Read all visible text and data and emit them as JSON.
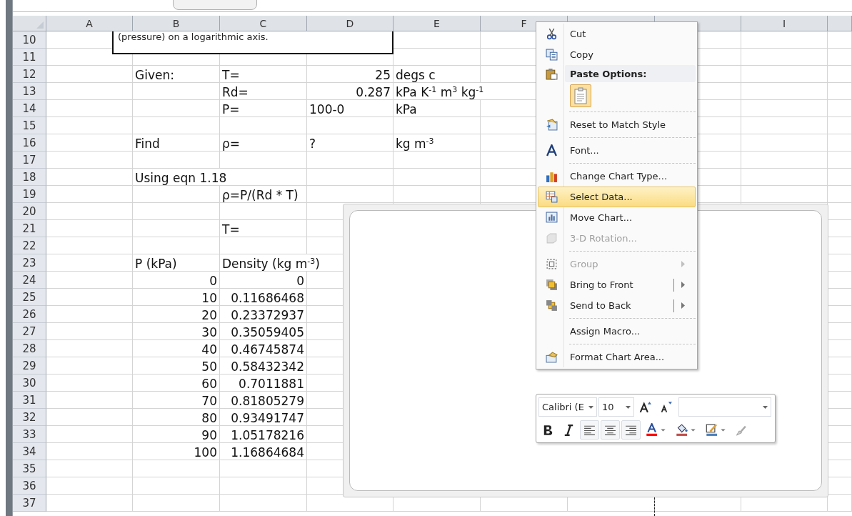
{
  "columns": [
    {
      "label": "A"
    },
    {
      "label": "B"
    },
    {
      "label": "C"
    },
    {
      "label": "D"
    },
    {
      "label": "E"
    },
    {
      "label": "F"
    },
    {},
    {},
    {
      "label": "I"
    }
  ],
  "text_box": {
    "text": "(pressure) on a logarithmic axis."
  },
  "rows": [
    {
      "number": "10",
      "cells": {}
    },
    {
      "number": "11",
      "cells": {}
    },
    {
      "number": "12",
      "cells": {
        "B": {
          "text": "Given:",
          "right_aligned": false
        },
        "C": {
          "text": "T=",
          "right_aligned": false
        },
        "D": {
          "text": "25",
          "right_aligned": true
        },
        "E": {
          "text": "degs c",
          "right_aligned": false
        }
      }
    },
    {
      "number": "13",
      "cells": {
        "C": {
          "text": "Rd=",
          "right_aligned": false
        },
        "D": {
          "text": "0.287",
          "right_aligned": true
        },
        "E": {
          "text": "kPa K$^{-1}$ m$^{3}$ kg$^{-1}$",
          "right_aligned": false
        }
      }
    },
    {
      "number": "14",
      "cells": {
        "C": {
          "text": "P=",
          "right_aligned": false
        },
        "D": {
          "text": "100-0",
          "right_aligned": false
        },
        "E": {
          "text": "kPa",
          "right_aligned": false
        }
      }
    },
    {
      "number": "15",
      "cells": {}
    },
    {
      "number": "16",
      "cells": {
        "B": {
          "text": "Find",
          "right_aligned": false
        },
        "C": {
          "text": "ρ=",
          "right_aligned": false
        },
        "D": {
          "text": "?",
          "right_aligned": false
        },
        "E": {
          "text": "kg m$^{-3}$",
          "right_aligned": false
        }
      }
    },
    {
      "number": "17",
      "cells": {}
    },
    {
      "number": "18",
      "cells": {
        "B": {
          "text": "Using eqn 1.18",
          "right_aligned": false
        }
      }
    },
    {
      "number": "19",
      "cells": {
        "C": {
          "text": "ρ=P/(Rd * T)",
          "right_aligned": false
        }
      }
    },
    {
      "number": "20",
      "cells": {}
    },
    {
      "number": "21",
      "cells": {
        "C": {
          "text": "T=",
          "right_aligned": false
        }
      }
    },
    {
      "number": "22",
      "cells": {}
    },
    {
      "number": "23",
      "cells": {
        "B": {
          "text": "P (kPa)",
          "right_aligned": false
        },
        "C": {
          "text": "Density (kg m$^{-3}$)",
          "right_aligned": false
        }
      }
    },
    {
      "number": "24",
      "cells": {
        "B": {
          "text": "0",
          "right_aligned": true
        },
        "C": {
          "text": "0",
          "right_aligned": true
        }
      }
    },
    {
      "number": "25",
      "cells": {
        "B": {
          "text": "10",
          "right_aligned": true
        },
        "C": {
          "text": "0.11686468",
          "right_aligned": true
        }
      }
    },
    {
      "number": "26",
      "cells": {
        "B": {
          "text": "20",
          "right_aligned": true
        },
        "C": {
          "text": "0.23372937",
          "right_aligned": true
        }
      }
    },
    {
      "number": "27",
      "cells": {
        "B": {
          "text": "30",
          "right_aligned": true
        },
        "C": {
          "text": "0.35059405",
          "right_aligned": true
        }
      }
    },
    {
      "number": "28",
      "cells": {
        "B": {
          "text": "40",
          "right_aligned": true
        },
        "C": {
          "text": "0.46745874",
          "right_aligned": true
        }
      }
    },
    {
      "number": "29",
      "cells": {
        "B": {
          "text": "50",
          "right_aligned": true
        },
        "C": {
          "text": "0.58432342",
          "right_aligned": true
        }
      }
    },
    {
      "number": "30",
      "cells": {
        "B": {
          "text": "60",
          "right_aligned": true
        },
        "C": {
          "text": "0.7011881",
          "right_aligned": true
        }
      }
    },
    {
      "number": "31",
      "cells": {
        "B": {
          "text": "70",
          "right_aligned": true
        },
        "C": {
          "text": "0.81805279",
          "right_aligned": true
        }
      }
    },
    {
      "number": "32",
      "cells": {
        "B": {
          "text": "80",
          "right_aligned": true
        },
        "C": {
          "text": "0.93491747",
          "right_aligned": true
        }
      }
    },
    {
      "number": "33",
      "cells": {
        "B": {
          "text": "90",
          "right_aligned": true
        },
        "C": {
          "text": "1.05178216",
          "right_aligned": true
        }
      }
    },
    {
      "number": "34",
      "cells": {
        "B": {
          "text": "100",
          "right_aligned": true
        },
        "C": {
          "text": "1.16864684",
          "right_aligned": true
        }
      }
    },
    {
      "number": "35",
      "cells": {}
    },
    {
      "number": "36",
      "cells": {}
    },
    {
      "number": "37",
      "cells": {}
    }
  ],
  "context_menu": {
    "items": [
      {
        "kind": "item",
        "label": "Cut",
        "selected": false,
        "disabled": false,
        "submenu": false,
        "split": false,
        "separator_before": false
      },
      {
        "kind": "item",
        "label": "Copy",
        "selected": false,
        "disabled": false,
        "submenu": false,
        "split": false,
        "separator_before": false
      },
      {
        "kind": "header",
        "label": "Paste Options:",
        "separator_before": false
      },
      {
        "kind": "paste",
        "selected": true,
        "separator_before": false
      },
      {
        "kind": "item",
        "label": "Reset to Match Style",
        "selected": false,
        "disabled": false,
        "submenu": false,
        "split": false,
        "separator_before": true
      },
      {
        "kind": "item",
        "label": "Font...",
        "selected": false,
        "disabled": false,
        "submenu": false,
        "split": false,
        "separator_before": true
      },
      {
        "kind": "item",
        "label": "Change Chart Type...",
        "selected": false,
        "disabled": false,
        "submenu": false,
        "split": false,
        "separator_before": true
      },
      {
        "kind": "item",
        "label": "Select Data...",
        "selected": true,
        "disabled": false,
        "submenu": false,
        "split": false,
        "separator_before": false
      },
      {
        "kind": "item",
        "label": "Move Chart...",
        "selected": false,
        "disabled": false,
        "submenu": false,
        "split": false,
        "separator_before": false
      },
      {
        "kind": "item",
        "label": "3-D Rotation...",
        "selected": false,
        "disabled": true,
        "submenu": false,
        "split": false,
        "separator_before": false
      },
      {
        "kind": "item",
        "label": "Group",
        "selected": false,
        "disabled": true,
        "submenu": true,
        "split": false,
        "separator_before": true
      },
      {
        "kind": "item",
        "label": "Bring to Front",
        "selected": false,
        "disabled": false,
        "submenu": true,
        "split": true,
        "separator_before": false
      },
      {
        "kind": "item",
        "label": "Send to Back",
        "selected": false,
        "disabled": false,
        "submenu": true,
        "split": true,
        "separator_before": false
      },
      {
        "kind": "item",
        "label": "Assign Macro...",
        "selected": false,
        "disabled": false,
        "submenu": false,
        "split": false,
        "separator_before": true
      },
      {
        "kind": "item",
        "label": "Format Chart Area...",
        "selected": false,
        "disabled": false,
        "submenu": false,
        "split": false,
        "separator_before": true
      }
    ]
  },
  "mini_toolbar": {
    "font": "Calibri (E",
    "size": "10"
  }
}
